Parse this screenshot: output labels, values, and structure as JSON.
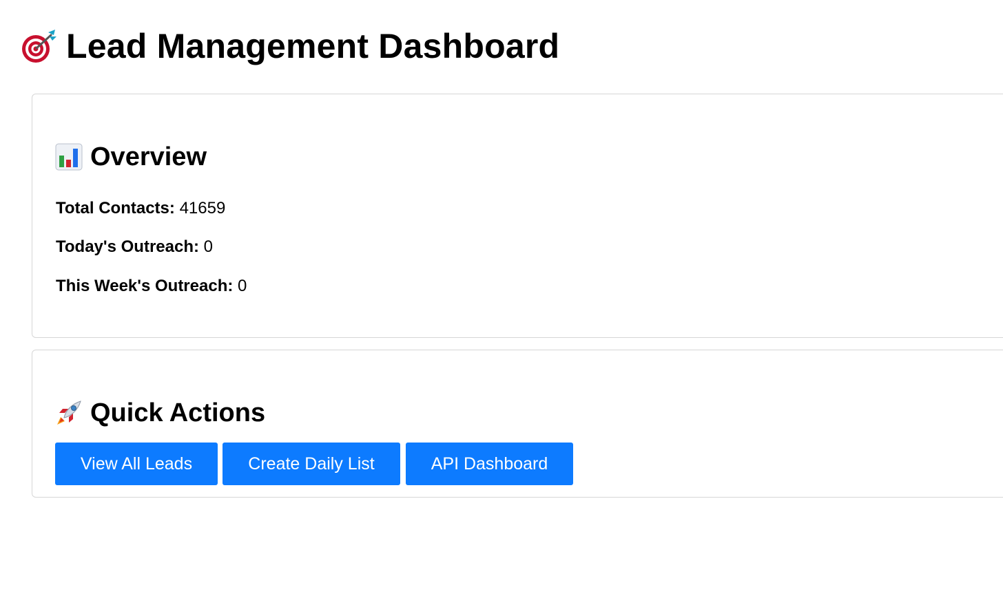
{
  "header": {
    "title": "Lead Management Dashboard",
    "icon": "target-dart-icon"
  },
  "overview": {
    "heading": "Overview",
    "icon": "bar-chart-icon",
    "stats": [
      {
        "label": "Total Contacts:",
        "value": "41659"
      },
      {
        "label": "Today's Outreach:",
        "value": "0"
      },
      {
        "label": "This Week's Outreach:",
        "value": "0"
      }
    ]
  },
  "quick_actions": {
    "heading": "Quick Actions",
    "icon": "rocket-icon",
    "buttons": [
      {
        "label": "View All Leads"
      },
      {
        "label": "Create Daily List"
      },
      {
        "label": "API Dashboard"
      }
    ]
  },
  "colors": {
    "button_bg": "#0d7bff",
    "button_text": "#ffffff",
    "card_border": "#d6d6d6"
  }
}
